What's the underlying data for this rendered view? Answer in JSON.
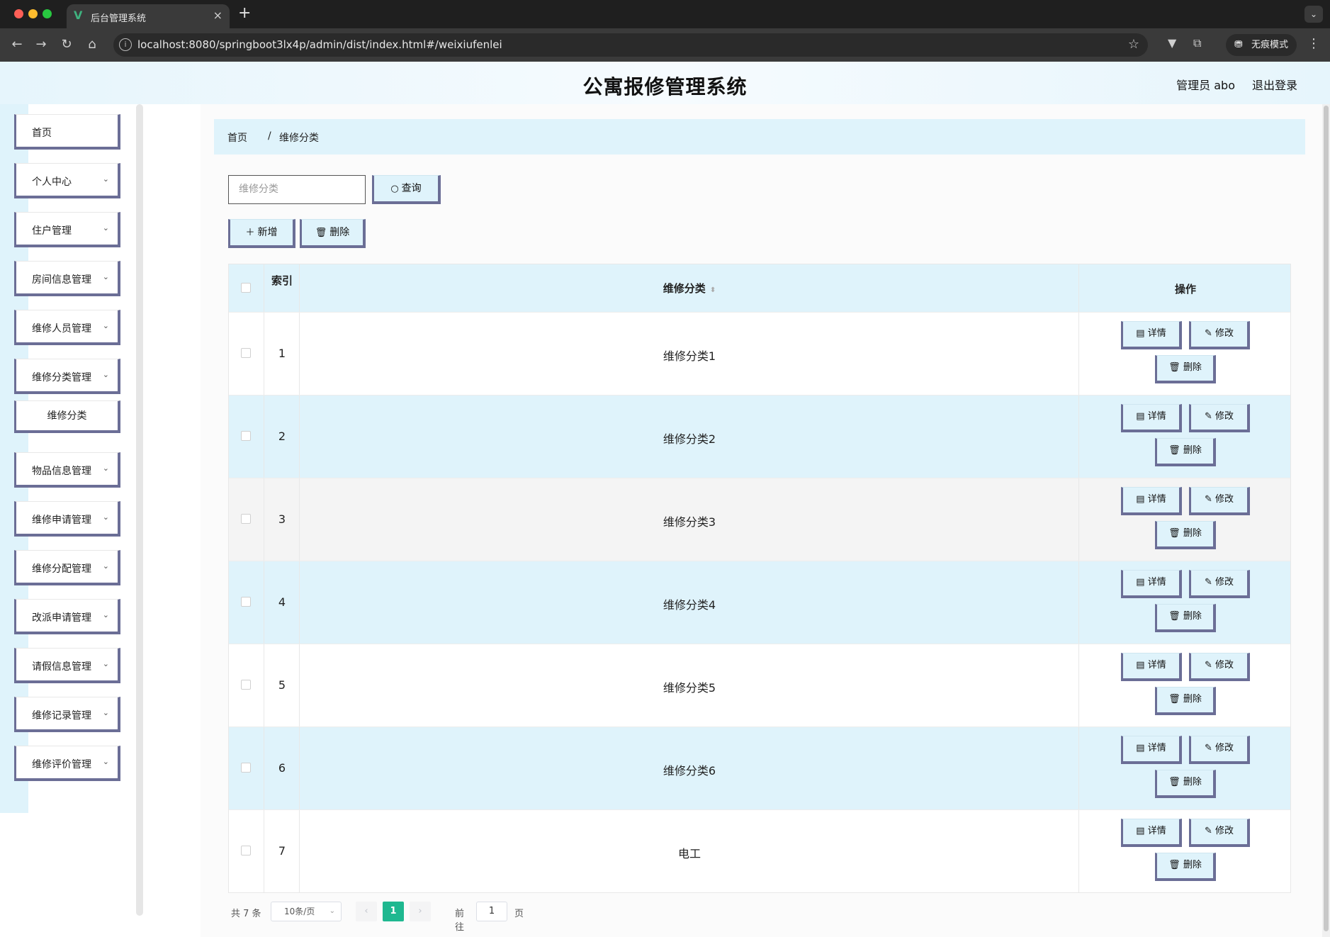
{
  "browser": {
    "tab_title": "后台管理系统",
    "url": "localhost:8080/springboot3lx4p/admin/dist/index.html#/weixiufenlei",
    "incognito_label": "无痕模式"
  },
  "header": {
    "title": "公寓报修管理系统",
    "user": "管理员 abo",
    "logout": "退出登录"
  },
  "sidebar": {
    "items": [
      {
        "label": "首页"
      },
      {
        "label": "个人中心"
      },
      {
        "label": "住户管理"
      },
      {
        "label": "房间信息管理"
      },
      {
        "label": "维修人员管理"
      },
      {
        "label": "维修分类管理"
      },
      {
        "label": "维修分类"
      },
      {
        "label": "物品信息管理"
      },
      {
        "label": "维修申请管理"
      },
      {
        "label": "维修分配管理"
      },
      {
        "label": "改派申请管理"
      },
      {
        "label": "请假信息管理"
      },
      {
        "label": "维修记录管理"
      },
      {
        "label": "维修评价管理"
      }
    ]
  },
  "breadcrumb": {
    "home": "首页",
    "separator": "/",
    "current": "维修分类"
  },
  "search": {
    "placeholder": "维修分类",
    "query_label": "查询"
  },
  "actions": {
    "add_label": "新增",
    "delete_label": "删除"
  },
  "table": {
    "headers": {
      "index": "索引",
      "name": "维修分类",
      "ops": "操作"
    },
    "row_buttons": {
      "detail": "详情",
      "edit": "修改",
      "delete": "删除"
    },
    "rows": [
      {
        "index": "1",
        "name": "维修分类1"
      },
      {
        "index": "2",
        "name": "维修分类2"
      },
      {
        "index": "3",
        "name": "维修分类3"
      },
      {
        "index": "4",
        "name": "维修分类4"
      },
      {
        "index": "5",
        "name": "维修分类5"
      },
      {
        "index": "6",
        "name": "维修分类6"
      },
      {
        "index": "7",
        "name": "电工"
      }
    ]
  },
  "pagination": {
    "total": "共 7 条",
    "page_size": "10条/页",
    "current_page": "1",
    "goto_label": "前往",
    "goto_value": "1",
    "page_unit": "页"
  },
  "colors": {
    "accent": "#dff3fb",
    "border_accent": "#6b6e96",
    "active_page": "#1fb890"
  }
}
